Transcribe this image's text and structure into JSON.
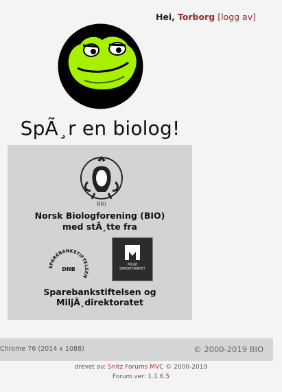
{
  "header": {
    "greeting": "Hei,",
    "username": "Torborg",
    "logout_open": "[",
    "logout_label": "logg av",
    "logout_close": "]"
  },
  "site": {
    "title": "SpÃ¸r en biolog!"
  },
  "sponsors": {
    "bio_logo_text": "BIO",
    "bio_line1": "Norsk Biologforening (BIO)",
    "bio_line2": "med stÃ¸tte fra",
    "dnb_ring_text": "SPAREBANKSTIFTELSEN",
    "dnb_center_text": "DNB",
    "miljo_line1": "MILJØ",
    "miljo_line2": "DIREKTORATET",
    "sponsor_line": "Sparebankstiftelsen og MiljÃ¸direktoratet"
  },
  "footer": {
    "browser_info": "Chrome 76 (2014 x 1088)",
    "copyright": "© 2000-2019 BIO",
    "powered_prefix": "drevet av:",
    "powered_link": "Snitz Forums MVC",
    "powered_suffix": "© 2000-2019",
    "version": "Forum ver: 1.1.6.5"
  },
  "colors": {
    "accent": "#8c2a2a",
    "frog_green": "#a6f000",
    "panel": "#d3d3d3"
  }
}
